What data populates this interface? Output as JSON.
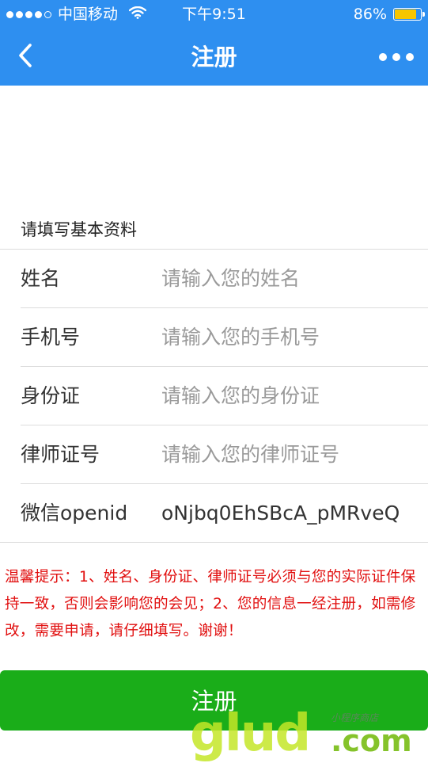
{
  "status_bar": {
    "carrier": "中国移动",
    "time": "下午9:51",
    "battery_percent": "86%",
    "battery_level": 0.86,
    "signal_bars": 4,
    "signal_total": 5
  },
  "navbar": {
    "title": "注册",
    "back_icon": "chevron-left-icon",
    "more_icon": "more-dots-icon"
  },
  "form": {
    "section_title": "请填写基本资料",
    "fields": [
      {
        "label": "姓名",
        "value": "",
        "placeholder": "请输入您的姓名"
      },
      {
        "label": "手机号",
        "value": "",
        "placeholder": "请输入您的手机号"
      },
      {
        "label": "身份证",
        "value": "",
        "placeholder": "请输入您的身份证"
      },
      {
        "label": "律师证号",
        "value": "",
        "placeholder": "请输入您的律师证号"
      },
      {
        "label": "微信openid",
        "value": "oNjbq0EhSBcA_pMRveQ",
        "placeholder": ""
      }
    ]
  },
  "notice": "温馨提示：1、姓名、身份证、律师证号必须与您的实际证件保持一致，否则会影响您的会见；2、您的信息一经注册，如需修改，需要申请，请仔细填写。谢谢！",
  "register_button": "注册",
  "watermark": {
    "main": "glud",
    "suffix": ".com",
    "sub": "小程序商店"
  },
  "colors": {
    "header": "#2e8ff0",
    "button": "#1aad19",
    "notice": "#e10f0f",
    "battery": "#f7c600"
  }
}
